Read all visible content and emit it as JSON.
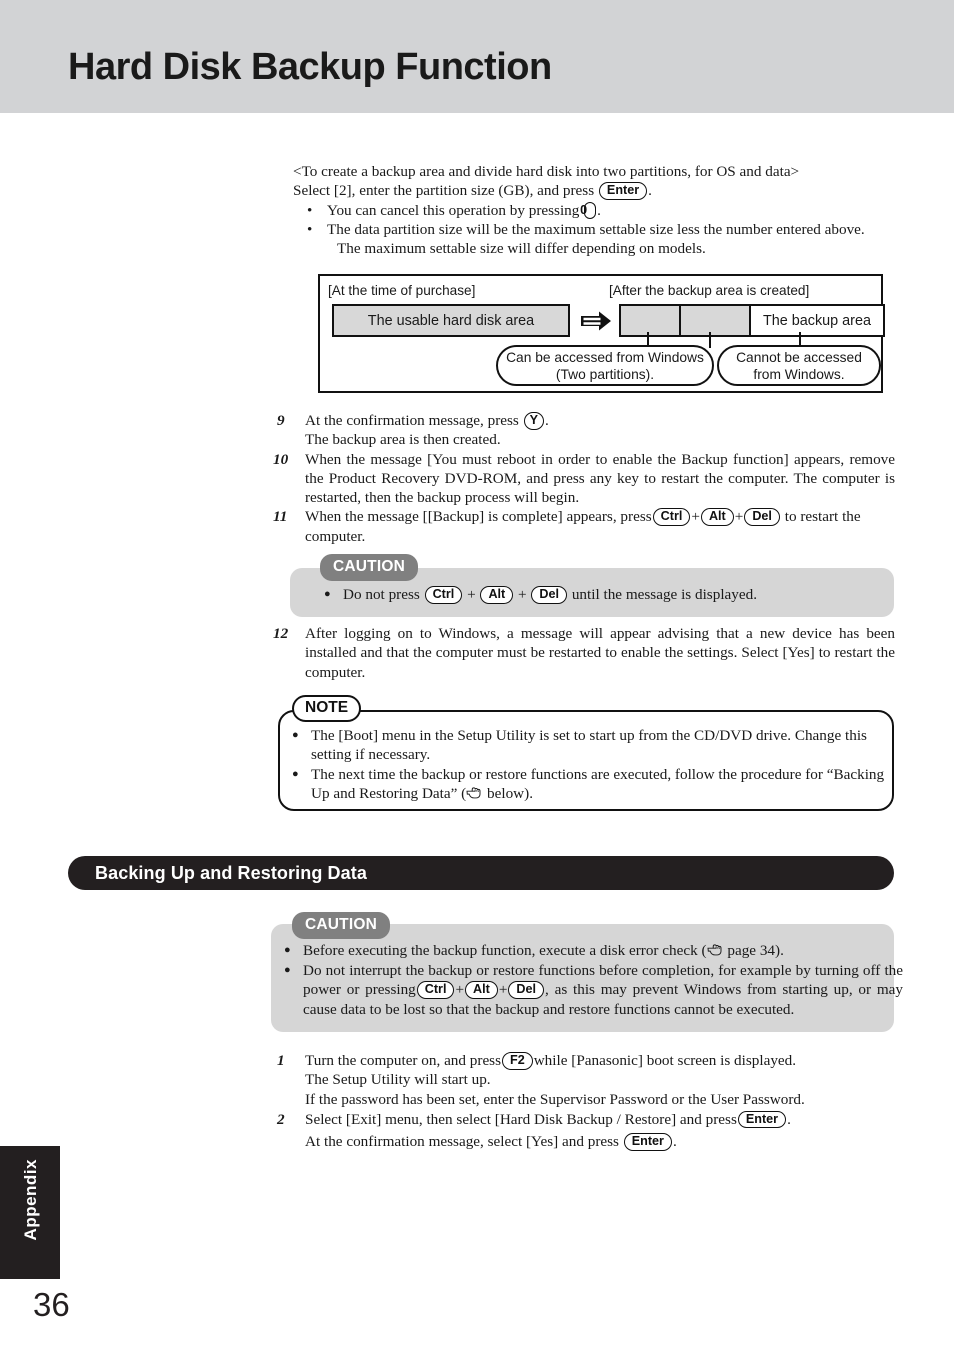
{
  "page": {
    "title": "Hard Disk Backup Function",
    "number": "36",
    "tab_label": "Appendix"
  },
  "intro": {
    "heading": "<To create a backup area and divide hard disk into two partitions, for OS and data>",
    "line2_pre": "Select [2], enter the partition size (GB), and press",
    "line2_key": "Enter",
    "line2_post": ".",
    "bullets": [
      {
        "pre": "You can cancel this operation by pressing",
        "key": "0",
        "post": "."
      },
      {
        "pre": "The data partition size will be the maximum settable size less the number entered above.",
        "key": "",
        "post": ""
      },
      {
        "pre": "The maximum settable size will differ depending on models.",
        "key": "",
        "post": ""
      }
    ]
  },
  "diagram": {
    "label_left": "[At the time of purchase]",
    "label_right": "[After the backup area is created]",
    "bar_old_label": "The usable hard disk area",
    "bar_new_backup_label": "The backup area",
    "callout_left": "Can be accessed from Windows (Two partitions).",
    "callout_right": "Cannot be accessed from Windows."
  },
  "steps_upper": [
    {
      "num": "9",
      "parts": [
        {
          "t": "At the confirmation message, press "
        },
        {
          "key": "Y"
        },
        {
          "t": "."
        }
      ],
      "extra": "The backup area is then created."
    },
    {
      "num": "10",
      "parts": [
        {
          "t": "When the message [You must reboot in order to enable the Backup function] appears, remove the Product Recovery DVD-ROM, and press any key to restart the computer. The computer is restarted, then the backup process will begin."
        }
      ],
      "extra": ""
    },
    {
      "num": "11",
      "parts": [
        {
          "t": "When the message [[Backup] is complete] appears, press"
        },
        {
          "key": "Ctrl"
        },
        {
          "t": "+"
        },
        {
          "key": "Alt"
        },
        {
          "t": "+"
        },
        {
          "key": "Del"
        },
        {
          "t": " to restart the computer."
        }
      ],
      "extra": ""
    }
  ],
  "caution1": {
    "badge": "CAUTION",
    "parts": [
      {
        "t": "Do not press "
      },
      {
        "key": "Ctrl"
      },
      {
        "t": " + "
      },
      {
        "key": "Alt"
      },
      {
        "t": " + "
      },
      {
        "key": "Del"
      },
      {
        "t": " until the message is displayed."
      }
    ]
  },
  "step12": {
    "num": "12",
    "text": "After logging on to Windows, a message will appear advising that a new device has been installed and that the computer must be restarted to enable the settings.  Select [Yes] to restart the computer."
  },
  "note": {
    "badge": "NOTE",
    "items": [
      {
        "text": "The [Boot] menu in the Setup Utility is set to start up from the CD/DVD drive. Change this setting if necessary."
      },
      {
        "pre": "The next time the backup or restore functions are executed, follow the procedure for “Backing Up and Restoring Data” (",
        "post": " below)."
      }
    ]
  },
  "section": {
    "title": "Backing Up and Restoring Data"
  },
  "caution2": {
    "badge": "CAUTION",
    "item1_pre": "Before executing the backup function, execute a disk error check (",
    "item1_post": " page 34).",
    "item2_parts": [
      {
        "t": "Do not interrupt the backup or restore functions before completion, for example by turning off the power or pressing"
      },
      {
        "key": "Ctrl"
      },
      {
        "t": "+"
      },
      {
        "key": "Alt"
      },
      {
        "t": "+"
      },
      {
        "key": "Del"
      },
      {
        "t": ", as this may prevent Windows from starting up, or may cause data to be lost so that the backup and restore functions cannot be executed."
      }
    ]
  },
  "steps_lower": [
    {
      "num": "1",
      "parts": [
        {
          "t": "Turn the computer on, and press"
        },
        {
          "key": "F2"
        },
        {
          "t": "while [Panasonic] boot screen is displayed."
        }
      ],
      "extra1": "The Setup Utility will start up.",
      "extra2": "If the password has been set, enter the Supervisor Password or the User Password."
    },
    {
      "num": "2",
      "parts": [
        {
          "t": "Select [Exit] menu, then select [Hard Disk Backup / Restore] and press"
        },
        {
          "key": "Enter"
        },
        {
          "t": "."
        }
      ],
      "extra1": "",
      "extra2": ""
    }
  ],
  "step2_confirm": {
    "pre": "At the confirmation message, select [Yes] and press ",
    "key": "Enter",
    "post": "."
  },
  "colors": {
    "header_band": "#d2d3d5",
    "caution_bg": "#d6d6d6",
    "badge_gray": "#808080",
    "section_black": "#231f20",
    "diagram_fill": "#d8d8d8"
  }
}
